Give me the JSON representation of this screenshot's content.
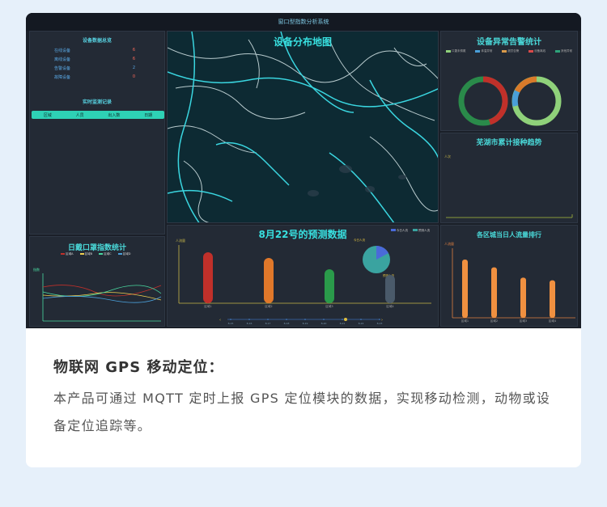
{
  "dashboard": {
    "title": "窗口型指数分析系统",
    "devices_panel": {
      "title": "设备数据总览",
      "stats": [
        {
          "label": "在线设备",
          "value": "6"
        },
        {
          "label": "离线设备",
          "value": "6"
        },
        {
          "label": "告警设备",
          "value": "2"
        },
        {
          "label": "故障设备",
          "value": "0"
        }
      ],
      "records_title": "实时监测记录",
      "table_headers": [
        "区域",
        "人员",
        "出入数",
        "日期"
      ]
    },
    "map_panel": {
      "title": "设备分布地图"
    },
    "alarm_panel": {
      "title": "设备异常告警统计",
      "legend": [
        "口罩未佩戴",
        "体温异常",
        "超员告警",
        "设备离线",
        "其他异常"
      ],
      "legend_colors": [
        "#8fd17a",
        "#4a9fd9",
        "#d99a4a",
        "#d94a4a",
        "#2ea37a"
      ]
    },
    "trend_panel": {
      "title": "芜湖市累计接种趋势",
      "ylabel": "人次"
    },
    "mask_panel": {
      "title": "日戴口罩指数统计",
      "legend": [
        "区域A",
        "区域B",
        "区域C",
        "区域D"
      ],
      "ylabel": "指数"
    },
    "predict_panel": {
      "title": "8月22号的预测数据",
      "legend": [
        "今日人流",
        "预测人流"
      ],
      "ylabel": "人流量",
      "pie_labels": [
        "今日人流",
        "预测人流"
      ],
      "bars": [
        {
          "label": "区域1",
          "value": 90,
          "color": "#c0302a"
        },
        {
          "label": "区域2",
          "value": 80,
          "color": "#e0782a"
        },
        {
          "label": "区域3",
          "value": 60,
          "color": "#2a9a4a"
        },
        {
          "label": "区域4",
          "value": 50,
          "color": "#4a5a6a"
        }
      ],
      "timeline": [
        "8-15",
        "8-16",
        "8-17",
        "8-18",
        "8-19",
        "8-20",
        "8-21",
        "8-22",
        "8-23"
      ]
    },
    "rank_panel": {
      "title": "各区城当日人流量排行",
      "ylabel": "人流量",
      "bars": [
        {
          "label": "区域1",
          "value": 90
        },
        {
          "label": "区域2",
          "value": 78
        },
        {
          "label": "区域3",
          "value": 62
        },
        {
          "label": "区域4",
          "value": 58
        }
      ]
    }
  },
  "feature": {
    "heading": "物联网 GPS 移动定位：",
    "description": "本产品可通过 MQTT 定时上报 GPS 定位模块的数据，实现移动检测，动物或设备定位追踪等。"
  }
}
